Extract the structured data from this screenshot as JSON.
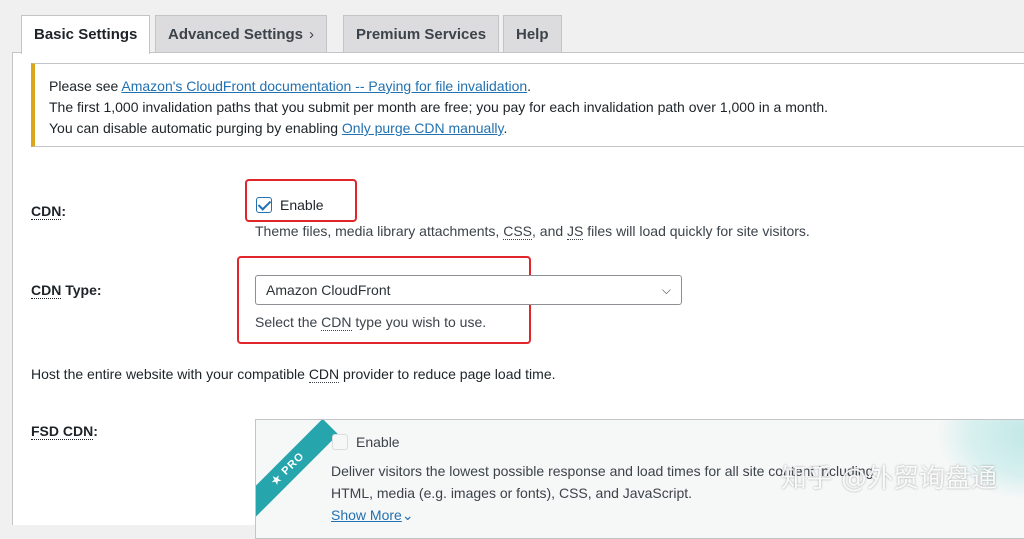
{
  "tabs": [
    {
      "label": "Basic Settings"
    },
    {
      "label": "Advanced Settings"
    },
    {
      "label": "Premium Services"
    },
    {
      "label": "Help"
    }
  ],
  "tab_chevron": "›",
  "notice": {
    "line1_prefix": "Please see ",
    "line1_link": "Amazon's CloudFront documentation -- Paying for file invalidation",
    "line1_suffix": ".",
    "line2": "The first 1,000 invalidation paths that you submit per month are free; you pay for each invalidation path over 1,000 in a month.",
    "line3_prefix": "You can disable automatic purging by enabling ",
    "line3_link": "Only purge CDN manually",
    "line3_suffix": "."
  },
  "cdn": {
    "label_abbr": "CDN",
    "label_suffix": ":",
    "checkbox_label": "Enable",
    "checked": true,
    "desc_p1": "Theme files, media library attachments, ",
    "desc_css": "CSS",
    "desc_p2": ", and ",
    "desc_js": "JS",
    "desc_p3": " files will load quickly for site visitors."
  },
  "cdn_type": {
    "label_abbr": "CDN",
    "label_suffix": " Type:",
    "selected": "Amazon CloudFront",
    "desc_p1": "Select the ",
    "desc_abbr": "CDN",
    "desc_p2": " type you wish to use."
  },
  "host_text": {
    "p1": "Host the entire website with your compatible ",
    "abbr": "CDN",
    "p2": " provider to reduce page load time."
  },
  "fsd_cdn": {
    "label_abbr": "FSD CDN",
    "label_suffix": ":",
    "ribbon": "★ PRO",
    "checkbox_label": "Enable",
    "checked": false,
    "desc_line1": "Deliver visitors the lowest possible response and load times for all site content including",
    "desc_line2": "HTML, media (e.g. images or fonts), CSS, and JavaScript.",
    "show_more": "Show More",
    "show_more_icon": "⌄"
  },
  "watermark": "知乎 @外贸询盘通",
  "colors": {
    "accent": "#2271b1",
    "notice_border": "#dba617",
    "highlight": "#e0252b",
    "ribbon": "#26a5ad"
  }
}
